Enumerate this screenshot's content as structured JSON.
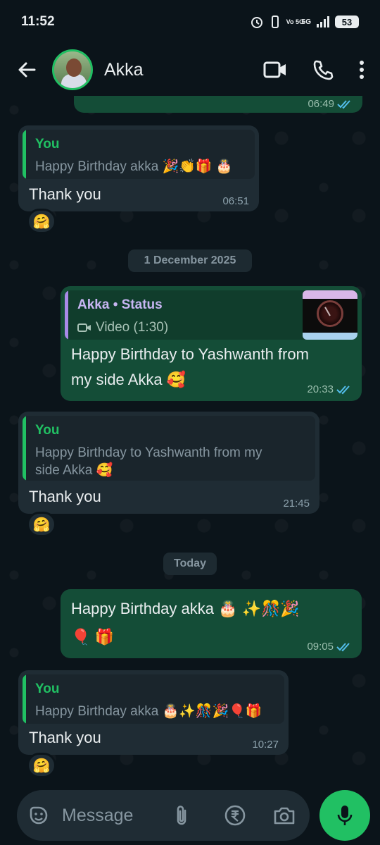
{
  "status_bar": {
    "time": "11:52",
    "network": "5G",
    "volte": "Vo 5G",
    "battery": "53"
  },
  "header": {
    "contact_name": "Akka"
  },
  "messages": [
    {
      "time": "06:49"
    },
    {
      "quote_author": "You",
      "quote_text": "Happy Birthday akka 🎉👏🎁 🎂",
      "text": "Thank you",
      "time": "06:51",
      "reaction": "🤗"
    },
    {
      "quote_author": "Akka • Status",
      "quote_text": "Video (1:30)",
      "text_line1": "Happy Birthday to Yashwanth from",
      "text_line2": "my side Akka 🥰",
      "time": "20:33"
    },
    {
      "quote_author": "You",
      "quote_text_line1": "Happy Birthday to Yashwanth from my",
      "quote_text_line2": "side Akka 🥰",
      "text": "Thank you",
      "time": "21:45",
      "reaction": "🤗"
    },
    {
      "text_line1": "Happy Birthday akka 🎂 ✨🎊🎉",
      "text_line2": "🎈 🎁",
      "time": "09:05"
    },
    {
      "quote_author": "You",
      "quote_text": "Happy Birthday akka 🎂✨🎊🎉🎈🎁",
      "text": "Thank you",
      "time": "10:27",
      "reaction": "🤗"
    }
  ],
  "dates": {
    "d1": "1 December 2025",
    "d2": "Today"
  },
  "composer": {
    "placeholder": "Message"
  },
  "colors": {
    "accent": "#21c063",
    "outgoing_bubble": "#144d37",
    "incoming_bubble": "#1f2c34",
    "read_tick": "#53bdeb"
  },
  "icons": [
    "back-arrow-icon",
    "video-call-icon",
    "phone-icon",
    "more-vert-icon",
    "sticker-icon",
    "attach-icon",
    "rupee-icon",
    "camera-icon",
    "mic-icon",
    "double-tick-icon"
  ]
}
